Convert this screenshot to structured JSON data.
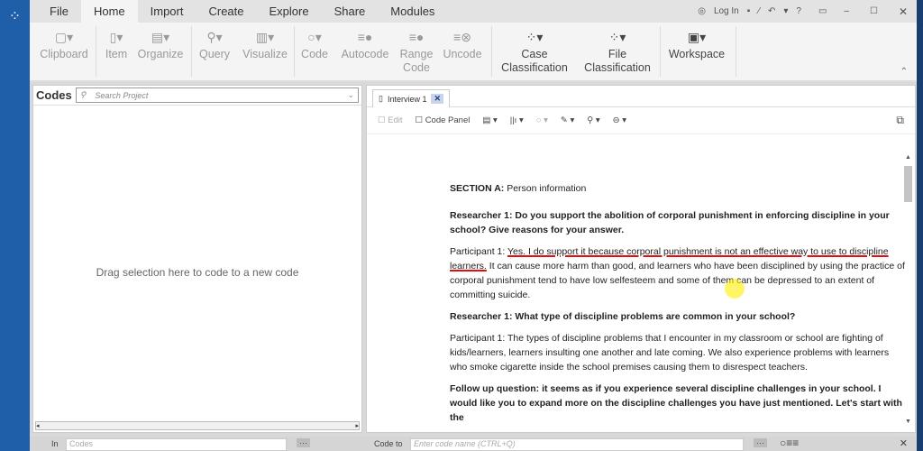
{
  "menu": [
    "File",
    "Home",
    "Import",
    "Create",
    "Explore",
    "Share",
    "Modules"
  ],
  "topright": {
    "login": "Log In",
    "help": "?"
  },
  "ribbon": [
    {
      "label": "Clipboard",
      "icon": "clipboard-icon"
    },
    {
      "label": "Item",
      "icon": "document-icon"
    },
    {
      "label": "Organize",
      "icon": "organize-icon"
    },
    {
      "label": "Query",
      "icon": "query-icon"
    },
    {
      "label": "Visualize",
      "icon": "chart-icon"
    },
    {
      "label": "Code",
      "icon": "circle-icon"
    },
    {
      "label": "Autocode",
      "icon": "autocode-icon"
    },
    {
      "label": "Range Code",
      "icon": "range-code-icon"
    },
    {
      "label": "Uncode",
      "icon": "uncode-icon"
    },
    {
      "label": "Case Classification",
      "icon": "case-classification-icon"
    },
    {
      "label": "File Classification",
      "icon": "file-classification-icon"
    },
    {
      "label": "Workspace",
      "icon": "workspace-icon"
    }
  ],
  "codes": {
    "title": "Codes",
    "search_placeholder": "Search Project",
    "empty": "Drag selection here to code to a new code"
  },
  "doc": {
    "tab": "Interview 1",
    "edit": "Edit",
    "code_panel": "Code Panel",
    "section": "SECTION A:",
    "section_rest": " Person information",
    "q1": "Researcher 1: Do you support the abolition of corporal punishment in enforcing discipline in your school? Give reasons for your answer.",
    "a1_label": "Participant 1: ",
    "a1_underlined": "Yes. I do support it because corporal punishment is not an effective way to use to discipline learners.",
    "a1_rest": " It can cause more harm than good, and learners who have been disciplined by using the practice of corporal punishment tend to have low selfesteem and some of them can be depressed to an extent of committing suicide.",
    "q2": "Researcher 1: What type of discipline problems are common in your school?",
    "a2": "Participant 1: The types of discipline problems that I encounter in my classroom or school are fighting of kids/learners, learners insulting one another and late coming. We also experience problems with learners who smoke cigarette inside the school premises causing them to disrespect teachers.",
    "q3": "Follow up question: it seems as if you experience several discipline challenges in your school. I would like you to expand more on the discipline challenges you have just mentioned. Let's start with the"
  },
  "bottom": {
    "in_label": "In",
    "in_value": "Codes",
    "code_to_label": "Code to",
    "code_to_placeholder": "Enter code name (CTRL+Q)"
  }
}
